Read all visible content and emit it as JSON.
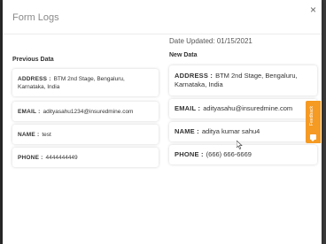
{
  "modal": {
    "title": "Form Logs",
    "close_glyph": "×",
    "date_updated": "Date Updated: 01/15/2021"
  },
  "previous": {
    "heading": "Previous Data",
    "fields": [
      {
        "label": "ADDRESS :",
        "value": "BTM 2nd Stage, Bengaluru, Karnataka, India"
      },
      {
        "label": "EMAIL :",
        "value": "adityasahu1234@insuredmine.com"
      },
      {
        "label": "NAME :",
        "value": "test"
      },
      {
        "label": "PHONE :",
        "value": "4444444449"
      }
    ]
  },
  "new": {
    "heading": "New Data",
    "fields": [
      {
        "label": "ADDRESS :",
        "value": "BTM 2nd Stage, Bengaluru, Karnataka, India"
      },
      {
        "label": "EMAIL :",
        "value": "adityasahu@insuredmine.com"
      },
      {
        "label": "NAME :",
        "value": "aditya kumar sahu4"
      },
      {
        "label": "PHONE :",
        "value": "(666) 666-6669"
      }
    ]
  },
  "feedback_tab": {
    "label": "Feedback",
    "icon": "chat-bubble-icon"
  },
  "colors": {
    "feedback": "#f59a23",
    "backdrop": "#3a3a3a"
  }
}
